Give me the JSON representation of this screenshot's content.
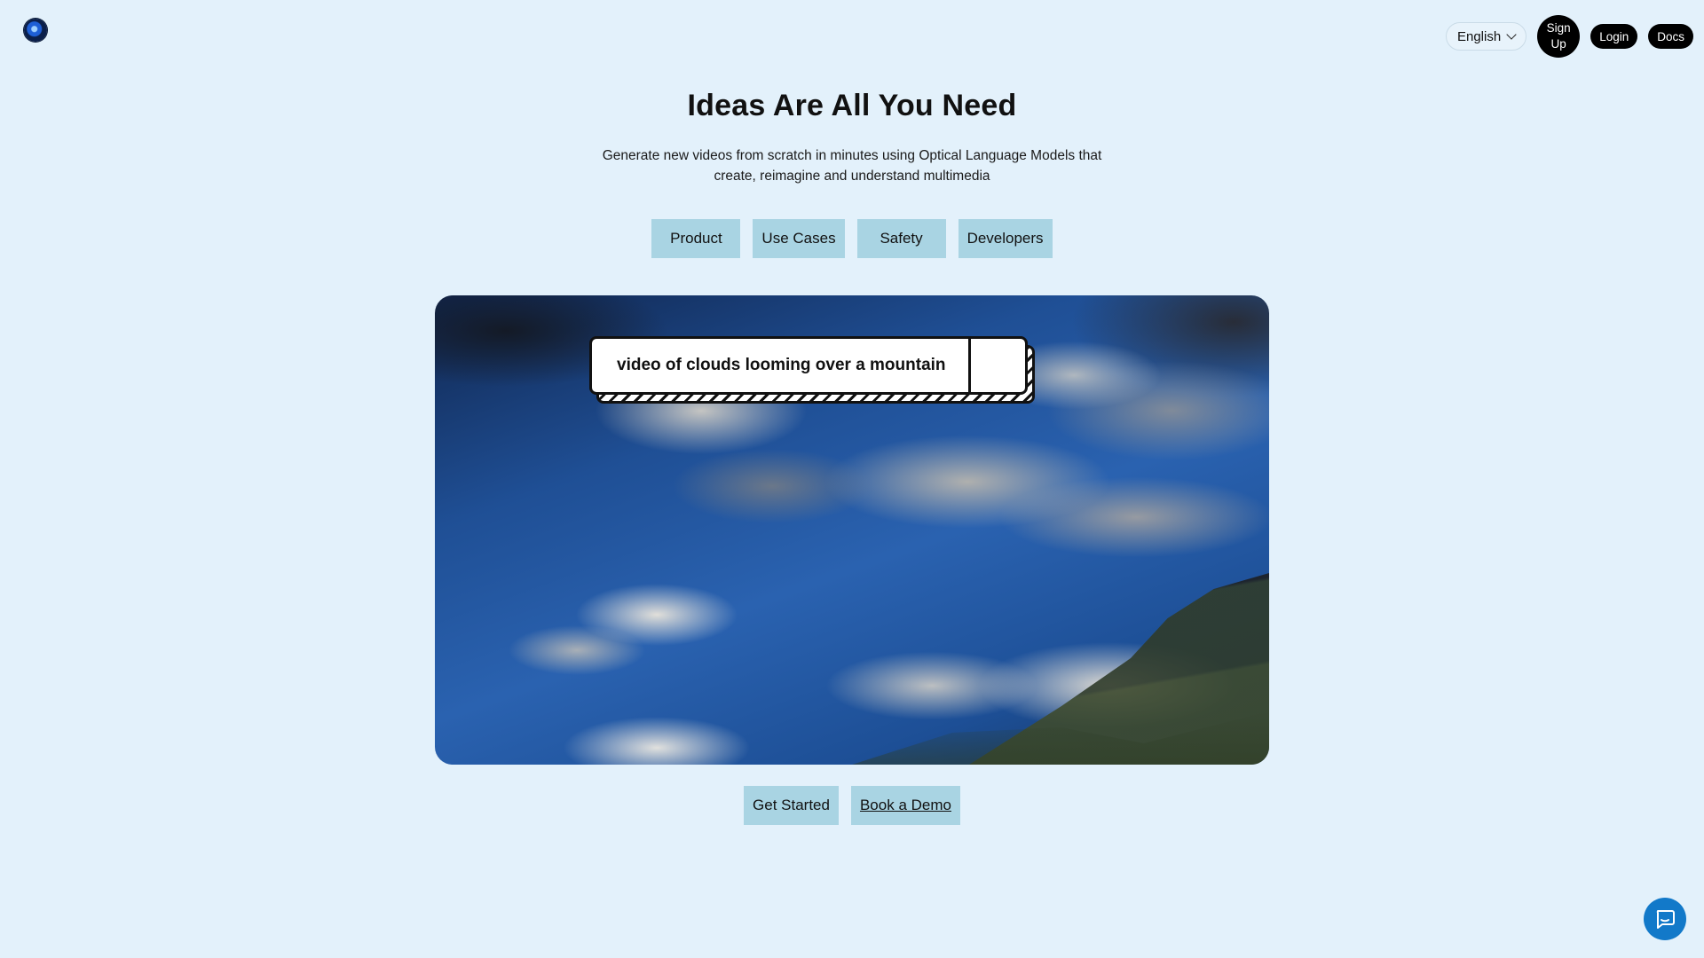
{
  "header": {
    "logo_icon": "eye-logo-icon",
    "language": {
      "selected": "English",
      "icon": "chevron-down-icon"
    },
    "signup_label": "Sign Up",
    "login_label": "Login",
    "docs_label": "Docs"
  },
  "hero": {
    "title": "Ideas Are All You Need",
    "subtitle": "Generate new videos from scratch in minutes using Optical Language Models that create, reimagine and understand multimedia"
  },
  "tabs": [
    {
      "label": "Product"
    },
    {
      "label": "Use Cases"
    },
    {
      "label": "Safety"
    },
    {
      "label": "Developers"
    }
  ],
  "video": {
    "prompt_text": "video of clouds looming over a mountain"
  },
  "ctas": {
    "get_started": "Get Started",
    "book_demo": "Book a Demo"
  },
  "chat": {
    "icon": "chat-bubble-icon"
  },
  "colors": {
    "background": "#e3f1fb",
    "button_bg": "#a9d4e3",
    "chat_accent": "#1279c9"
  }
}
